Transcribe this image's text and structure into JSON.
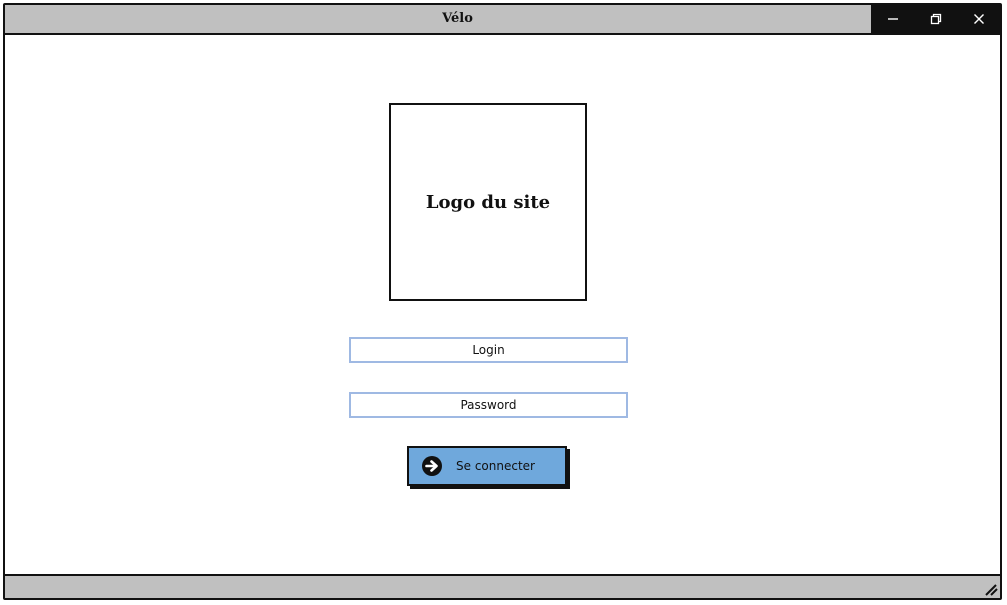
{
  "window": {
    "title": "Vélo"
  },
  "controls": {
    "icons": [
      "minimize-icon",
      "restore-icon",
      "close-icon"
    ]
  },
  "logo": {
    "label": "Logo du site"
  },
  "form": {
    "login_placeholder": "Login",
    "password_placeholder": "Password",
    "submit_label": "Se connecter",
    "submit_icon": "arrow-right-circle-icon"
  },
  "colors": {
    "titlebar": "#c0c0c0",
    "controls_bg": "#111111",
    "field_border": "#9fb9e3",
    "button_bg": "#6fa8dc"
  }
}
